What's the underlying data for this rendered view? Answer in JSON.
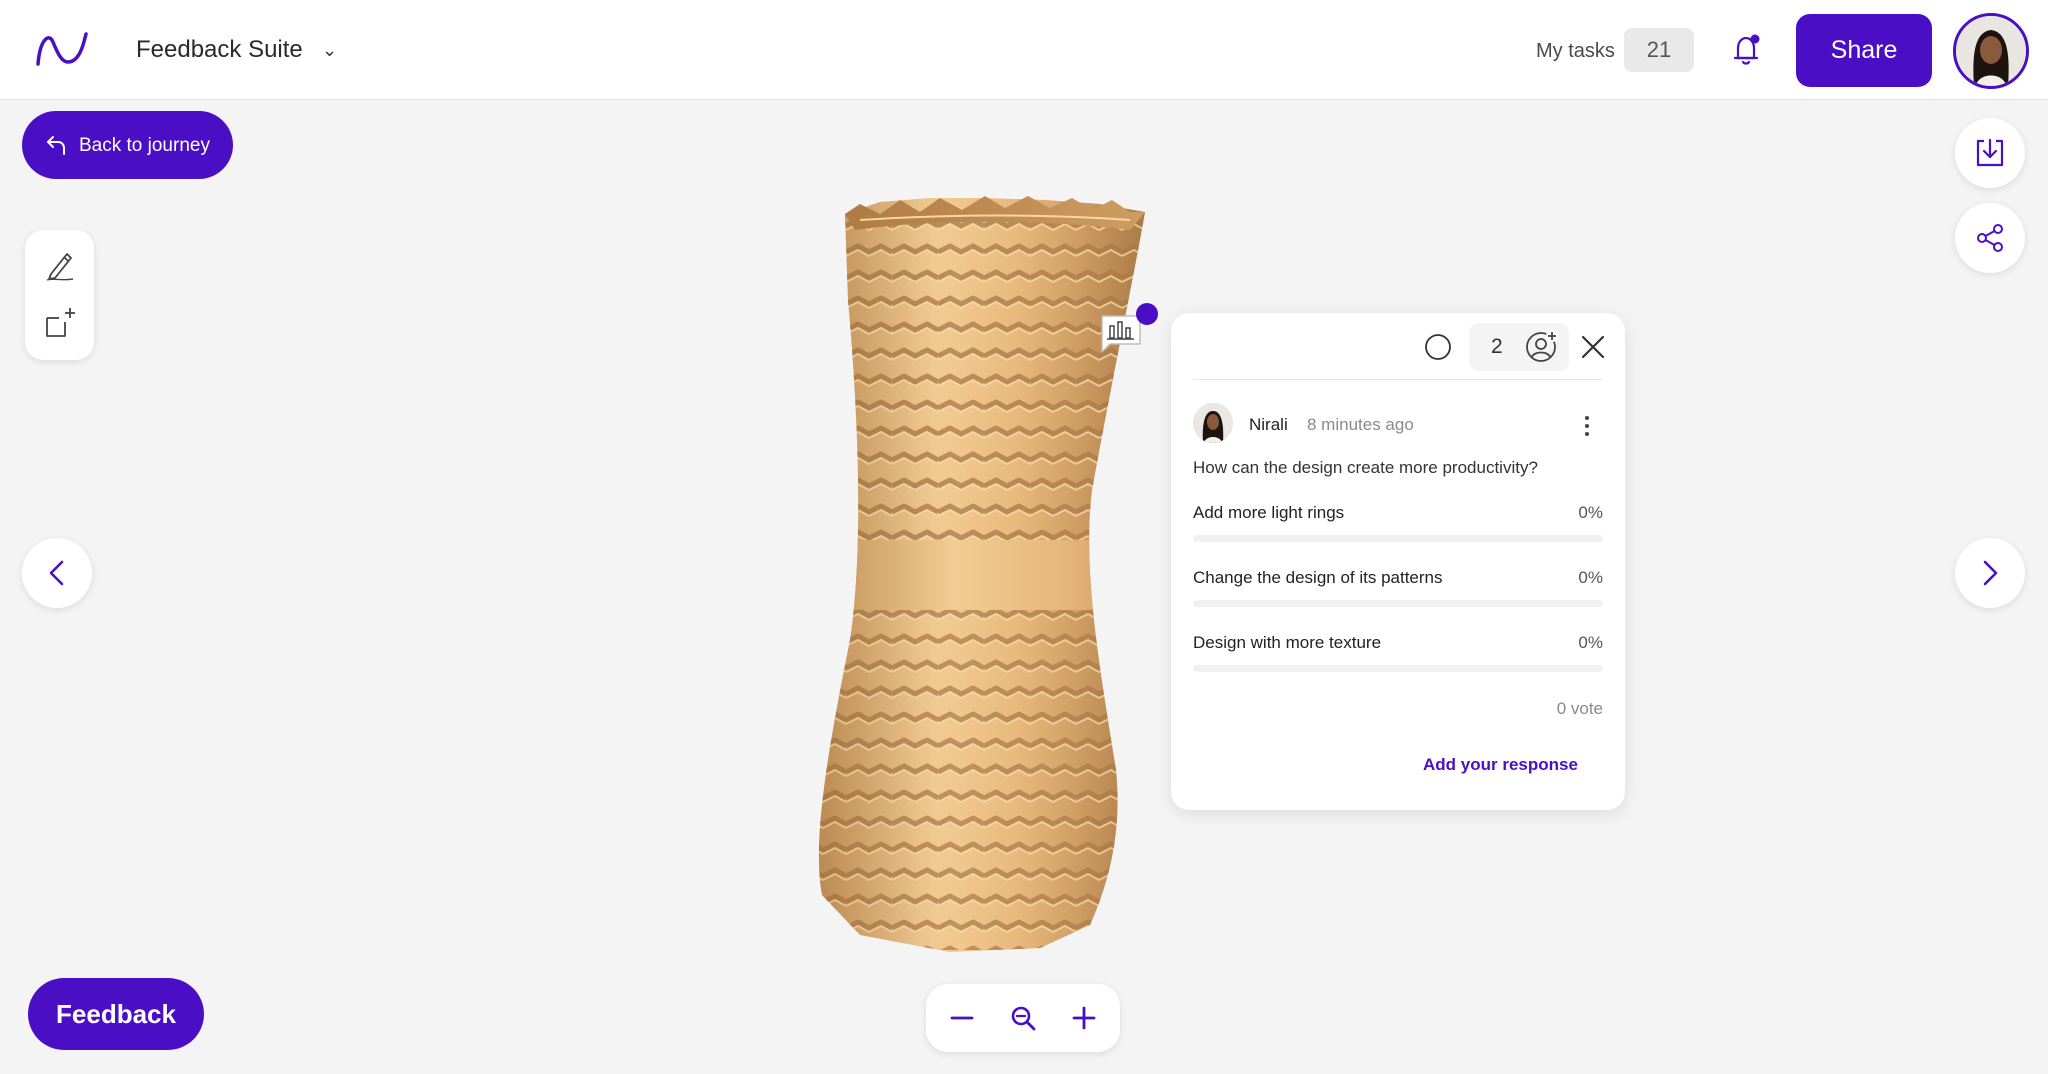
{
  "header": {
    "app_title": "Feedback Suite",
    "my_tasks_label": "My tasks",
    "tasks_count": "21",
    "share_label": "Share"
  },
  "back_button": {
    "label": "Back to journey"
  },
  "poll": {
    "participants_count": "2",
    "author": "Nirali",
    "time": "8 minutes ago",
    "question": "How can the design create more productivity?",
    "options": [
      {
        "label": "Add more light rings",
        "percent": "0%"
      },
      {
        "label": "Change the design of its patterns",
        "percent": "0%"
      },
      {
        "label": "Design with more texture",
        "percent": "0%"
      }
    ],
    "votes": "0 vote",
    "add_response": "Add your response"
  },
  "feedback_button": {
    "label": "Feedback"
  },
  "icons": {
    "logo": "logo-icon",
    "title_dropdown": "chevron-down-icon",
    "notifications": "bell-icon",
    "back": "back-arrow-icon",
    "pen_tool": "pen-icon",
    "add_frame": "add-frame-icon",
    "download": "download-icon",
    "share_network": "share-icon",
    "poll_marker": "poll-chart-icon",
    "resolve": "circle-icon",
    "add_participant": "add-user-icon",
    "close": "close-icon",
    "more": "more-vertical-icon",
    "prev": "chevron-left-icon",
    "next": "chevron-right-icon",
    "zoom_out": "minus-icon",
    "zoom_reset": "magnifier-icon",
    "zoom_in": "plus-icon"
  },
  "colors": {
    "brand": "#4a0fc4",
    "background": "#f4f4f4",
    "vase_light": "#f2cc94",
    "vase_dark": "#b9874f"
  }
}
